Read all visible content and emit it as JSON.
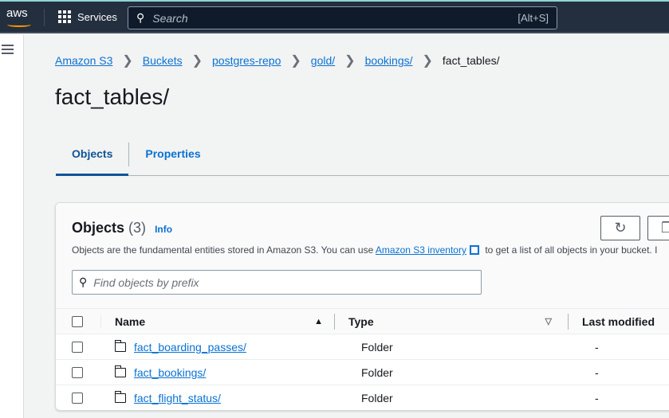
{
  "nav": {
    "logo": "aws",
    "services": "Services",
    "search_placeholder": "Search",
    "shortcut": "[Alt+S]"
  },
  "breadcrumbs": [
    "Amazon S3",
    "Buckets",
    "postgres-repo",
    "gold/",
    "bookings/",
    "fact_tables/"
  ],
  "page_title": "fact_tables/",
  "tabs": [
    {
      "label": "Objects",
      "active": true
    },
    {
      "label": "Properties",
      "active": false
    }
  ],
  "objects": {
    "title": "Objects",
    "count": "(3)",
    "info": "Info",
    "desc_before": "Objects are the fundamental entities stored in Amazon S3. You can use ",
    "desc_link": "Amazon S3 inventory",
    "desc_after": " to get a list of all objects in your bucket. I",
    "filter_placeholder": "Find objects by prefix",
    "columns": [
      "Name",
      "Type",
      "Last modified"
    ],
    "rows": [
      {
        "name": "fact_boarding_passes/",
        "type": "Folder",
        "modified": "-"
      },
      {
        "name": "fact_bookings/",
        "type": "Folder",
        "modified": "-"
      },
      {
        "name": "fact_flight_status/",
        "type": "Folder",
        "modified": "-"
      }
    ]
  }
}
